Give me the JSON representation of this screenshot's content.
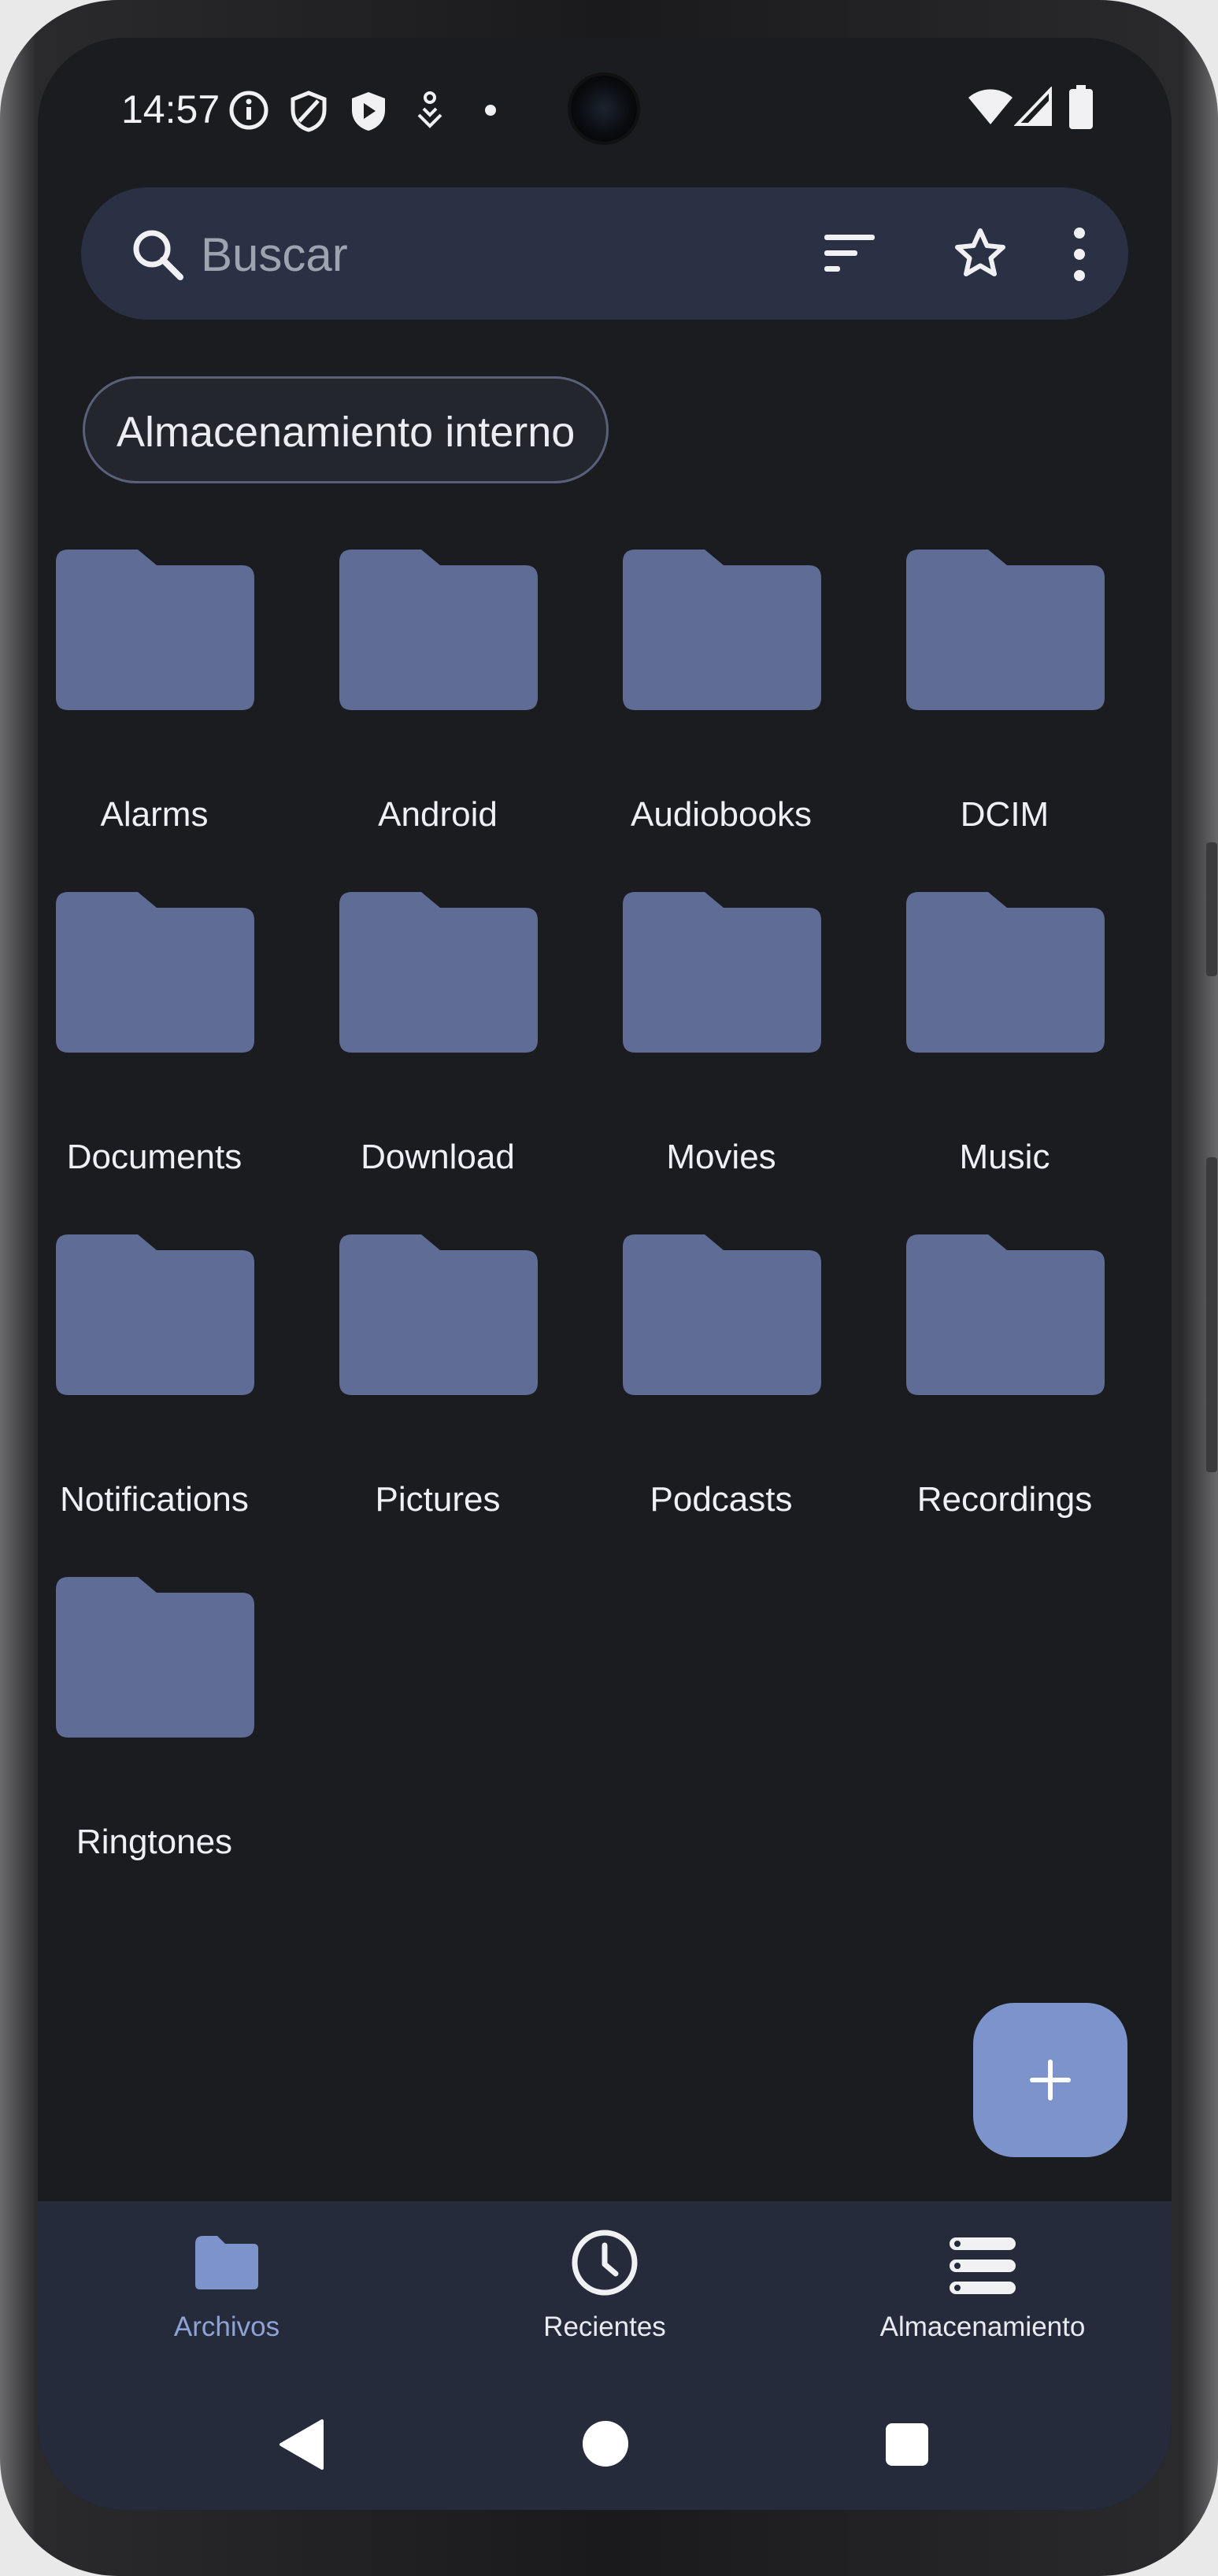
{
  "status_bar": {
    "time": "14:57"
  },
  "search": {
    "placeholder": "Buscar"
  },
  "storage_chip": {
    "label": "Almacenamiento interno"
  },
  "folders": [
    {
      "name": "Alarms"
    },
    {
      "name": "Android"
    },
    {
      "name": "Audiobooks"
    },
    {
      "name": "DCIM"
    },
    {
      "name": "Documents"
    },
    {
      "name": "Download"
    },
    {
      "name": "Movies"
    },
    {
      "name": "Music"
    },
    {
      "name": "Notifications"
    },
    {
      "name": "Pictures"
    },
    {
      "name": "Podcasts"
    },
    {
      "name": "Recordings"
    },
    {
      "name": "Ringtones"
    }
  ],
  "bottom_nav": {
    "items": [
      {
        "label": "Archivos",
        "icon": "folder-icon",
        "active": true
      },
      {
        "label": "Recientes",
        "icon": "clock-icon",
        "active": false
      },
      {
        "label": "Almacenamiento",
        "icon": "storage-icon",
        "active": false
      }
    ]
  },
  "colors": {
    "background": "#1b1c20",
    "folder": "#5f6d96",
    "accent": "#7c93cb",
    "search_bar": "#2b3144",
    "nav_bar": "#262b3c",
    "active_nav": "#8ea2d6"
  },
  "icons": {
    "search": "search-icon",
    "sort": "sort-icon",
    "favorites": "star-icon",
    "more": "more-vert-icon",
    "fab": "plus-icon"
  }
}
